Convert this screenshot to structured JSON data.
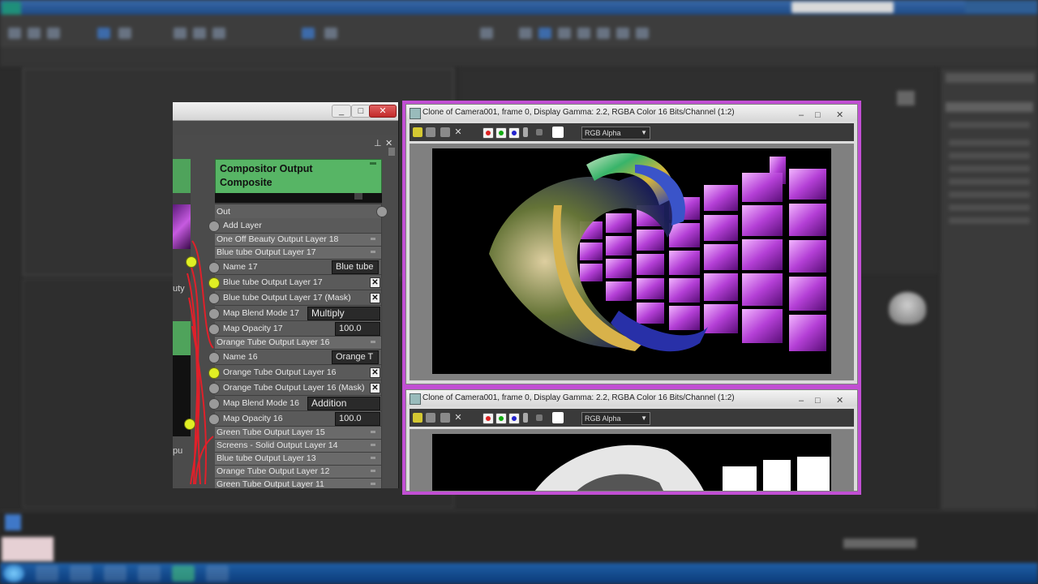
{
  "compositor_node": {
    "title_line1": "Compositor Output",
    "title_line2": "Composite",
    "out_label": "Out",
    "add_layer_label": "Add Layer",
    "rows": [
      {
        "kind": "hdr",
        "label": "One Off Beauty Output Layer 18"
      },
      {
        "kind": "hdr",
        "label": "Blue tube Output Layer 17"
      },
      {
        "kind": "sub",
        "label": "Name 17",
        "field": "Blue tube"
      },
      {
        "kind": "sub",
        "label": "Blue tube Output Layer 17",
        "x": "✕",
        "pin": "y"
      },
      {
        "kind": "sub",
        "label": "Blue tube Output Layer 17 (Mask)",
        "x": "✕"
      },
      {
        "kind": "sub",
        "label": "Map Blend Mode 17",
        "field": "Multiply"
      },
      {
        "kind": "sub",
        "label": "Map Opacity 17",
        "field": "100.0"
      },
      {
        "kind": "hdr",
        "label": "Orange Tube Output Layer 16"
      },
      {
        "kind": "sub",
        "label": "Name 16",
        "field": "Orange T"
      },
      {
        "kind": "sub",
        "label": "Orange Tube Output Layer 16",
        "x": "✕",
        "pin": "y"
      },
      {
        "kind": "sub",
        "label": "Orange Tube Output Layer 16 (Mask)",
        "x": "✕"
      },
      {
        "kind": "sub",
        "label": "Map Blend Mode 16",
        "field": "Addition"
      },
      {
        "kind": "sub",
        "label": "Map Opacity 16",
        "field": "100.0"
      },
      {
        "kind": "hdr",
        "label": "Green Tube Output Layer 15"
      },
      {
        "kind": "hdr",
        "label": "Screens - Solid Output Layer 14"
      },
      {
        "kind": "hdr",
        "label": "Blue tube Output Layer 13"
      },
      {
        "kind": "hdr",
        "label": "Orange Tube Output Layer 12"
      },
      {
        "kind": "hdr",
        "label": "Green Tube Output Layer 11"
      }
    ]
  },
  "left_nodes": {
    "node1_text": "uty",
    "node2_text": "pu"
  },
  "frame_buffer_top": {
    "title": "Clone of Camera001, frame 0, Display Gamma: 2.2, RGBA Color 16 Bits/Channel (1:2)",
    "channel_select": "RGB Alpha"
  },
  "frame_buffer_bottom": {
    "title": "Clone of Camera001, frame 0, Display Gamma: 2.2, RGBA Color 16 Bits/Channel (1:2)",
    "channel_select": "RGB Alpha"
  },
  "colors": {
    "node_header": "#57b565",
    "pin_active": "#e0ef24",
    "wire": "#e0202a",
    "fb_border": "#c14fd3",
    "slate_close": "#c22b2b"
  }
}
